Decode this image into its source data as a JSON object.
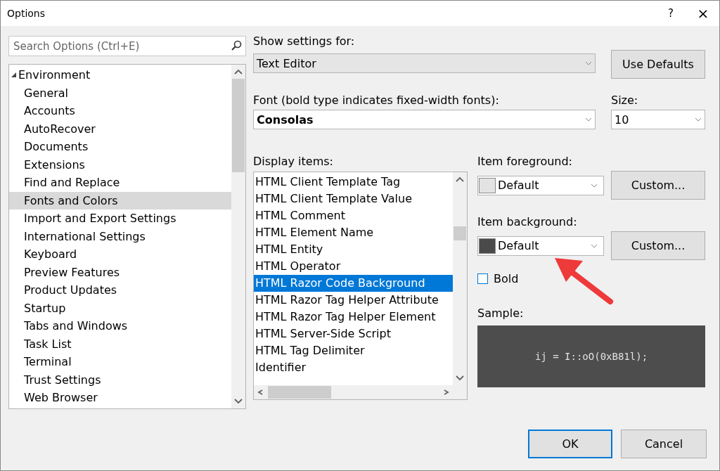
{
  "window": {
    "title": "Options",
    "help": "?",
    "close": "×"
  },
  "search": {
    "placeholder": "Search Options (Ctrl+E)"
  },
  "tree": [
    {
      "label": "Environment",
      "expanded": true,
      "selected": false,
      "children": [
        {
          "label": "General",
          "selected": false
        },
        {
          "label": "Accounts",
          "selected": false
        },
        {
          "label": "AutoRecover",
          "selected": false
        },
        {
          "label": "Documents",
          "selected": false
        },
        {
          "label": "Extensions",
          "selected": false
        },
        {
          "label": "Find and Replace",
          "selected": false
        },
        {
          "label": "Fonts and Colors",
          "selected": true
        },
        {
          "label": "Import and Export Settings",
          "selected": false
        },
        {
          "label": "International Settings",
          "selected": false
        },
        {
          "label": "Keyboard",
          "selected": false
        },
        {
          "label": "Preview Features",
          "selected": false
        },
        {
          "label": "Product Updates",
          "selected": false
        },
        {
          "label": "Startup",
          "selected": false
        },
        {
          "label": "Tabs and Windows",
          "selected": false
        },
        {
          "label": "Task List",
          "selected": false
        },
        {
          "label": "Terminal",
          "selected": false
        },
        {
          "label": "Trust Settings",
          "selected": false
        },
        {
          "label": "Web Browser",
          "selected": false
        }
      ]
    }
  ],
  "show_settings_for": {
    "label": "Show settings for:",
    "value": "Text Editor"
  },
  "use_defaults": "Use Defaults",
  "font": {
    "label": "Font (bold type indicates fixed-width fonts):",
    "value": "Consolas"
  },
  "size": {
    "label": "Size:",
    "value": "10"
  },
  "display_items": {
    "label": "Display items:",
    "items": [
      {
        "label": "HTML Client Template Tag",
        "selected": false
      },
      {
        "label": "HTML Client Template Value",
        "selected": false
      },
      {
        "label": "HTML Comment",
        "selected": false
      },
      {
        "label": "HTML Element Name",
        "selected": false
      },
      {
        "label": "HTML Entity",
        "selected": false
      },
      {
        "label": "HTML Operator",
        "selected": false
      },
      {
        "label": "HTML Razor Code Background",
        "selected": true
      },
      {
        "label": "HTML Razor Tag Helper Attribute",
        "selected": false
      },
      {
        "label": "HTML Razor Tag Helper Element",
        "selected": false
      },
      {
        "label": "HTML Server-Side Script",
        "selected": false
      },
      {
        "label": "HTML Tag Delimiter",
        "selected": false
      },
      {
        "label": "Identifier",
        "selected": false
      }
    ]
  },
  "color_settings": [
    {
      "label": "Item foreground:",
      "color": "#e3e3e3",
      "value": "Default",
      "button": "Custom..."
    },
    {
      "label": "Item background:",
      "color": "#4a4a4a",
      "value": "Default",
      "button": "Custom..."
    }
  ],
  "bold": {
    "label": "Bold",
    "checked": false
  },
  "sample": {
    "label": "Sample:",
    "text": "ij = I::oO(0xB81l);"
  },
  "buttons": [
    {
      "label": "OK",
      "default": true
    },
    {
      "label": "Cancel",
      "default": false
    }
  ]
}
